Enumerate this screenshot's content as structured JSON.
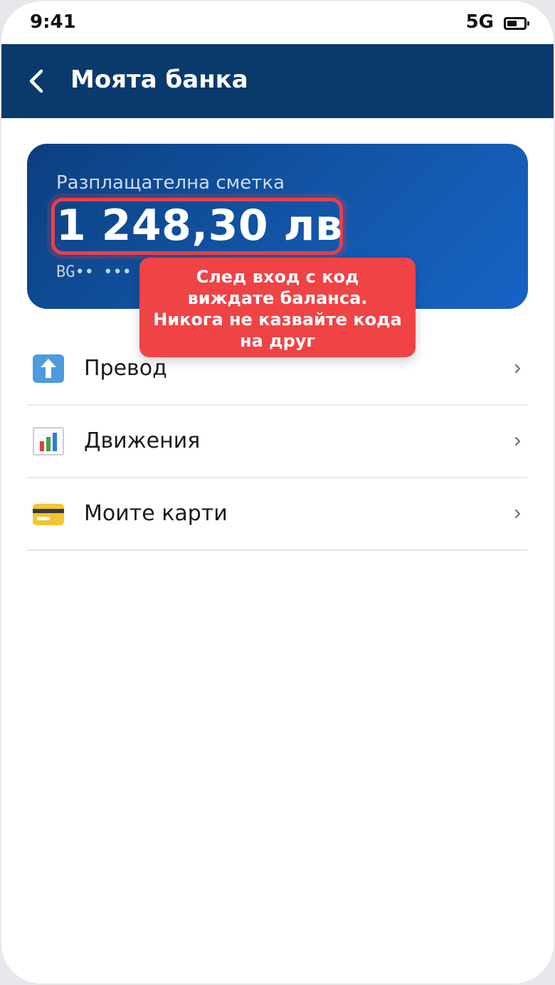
{
  "status_bar": {
    "time": "9:41",
    "network": "5G"
  },
  "header": {
    "title": "Моята банка"
  },
  "account": {
    "label": "Разплащателна сметка",
    "balance": "1 248,30 лв",
    "iban_masked": "BG•• •••"
  },
  "tooltip": {
    "text": "След вход с код виждате баланса. Никога не казвайте кода на друг"
  },
  "menu": {
    "items": [
      {
        "label": "Превод",
        "icon": "upload-arrow-icon"
      },
      {
        "label": "Движения",
        "icon": "bar-chart-icon"
      },
      {
        "label": "Моите карти",
        "icon": "credit-card-icon"
      }
    ]
  },
  "colors": {
    "header_bg": "#0a3a6b",
    "card_gradient_start": "#0c3f7f",
    "card_gradient_end": "#1763c5",
    "highlight": "#e8404a",
    "tooltip_bg": "#ef4346"
  }
}
